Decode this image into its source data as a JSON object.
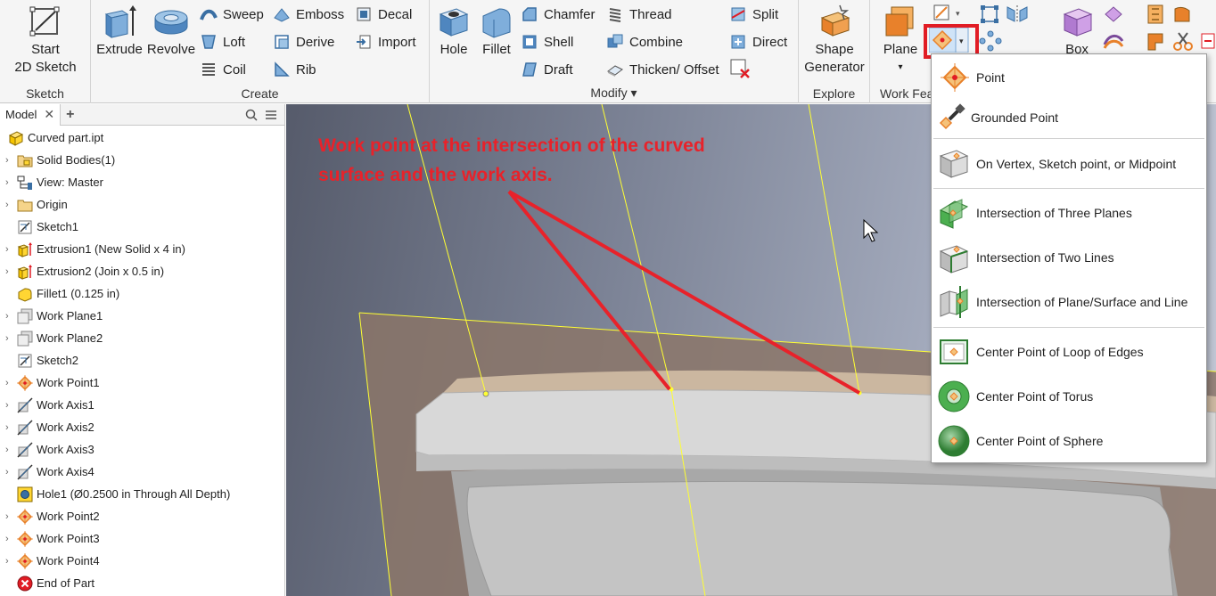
{
  "ribbon": {
    "sketch": {
      "start_label": "Start",
      "sketch_label": "2D Sketch",
      "group": "Sketch"
    },
    "create": {
      "group": "Create",
      "extrude": "Extrude",
      "revolve": "Revolve",
      "sweep": "Sweep",
      "loft": "Loft",
      "coil": "Coil",
      "emboss": "Emboss",
      "derive": "Derive",
      "rib": "Rib",
      "decal": "Decal",
      "import": "Import"
    },
    "modify": {
      "group": "Modify ▾",
      "hole": "Hole",
      "fillet": "Fillet",
      "chamfer": "Chamfer",
      "shell": "Shell",
      "draft": "Draft",
      "thread": "Thread",
      "combine": "Combine",
      "thicken": "Thicken/ Offset",
      "split": "Split",
      "direct": "Direct"
    },
    "explore": {
      "group": "Explore",
      "shape_line1": "Shape",
      "shape_line2": "Generator"
    },
    "work_features": {
      "group": "Work Fea",
      "plane": "Plane"
    },
    "box_label": "Box"
  },
  "browser": {
    "tab": "Model",
    "items": [
      {
        "label": "Curved part.ipt",
        "icon": "part-icon",
        "expander": false
      },
      {
        "label": "Solid Bodies(1)",
        "icon": "solid-bodies-icon",
        "expander": true
      },
      {
        "label": "View: Master",
        "icon": "view-icon",
        "expander": true
      },
      {
        "label": "Origin",
        "icon": "folder-icon",
        "expander": true
      },
      {
        "label": "Sketch1",
        "icon": "sketch-icon",
        "expander": false
      },
      {
        "label": "Extrusion1 (New Solid x 4 in)",
        "icon": "extrusion-icon",
        "expander": true
      },
      {
        "label": "Extrusion2 (Join x 0.5 in)",
        "icon": "extrusion-icon",
        "expander": true
      },
      {
        "label": "Fillet1 (0.125 in)",
        "icon": "fillet-icon",
        "expander": false
      },
      {
        "label": "Work Plane1",
        "icon": "work-plane-icon",
        "expander": true
      },
      {
        "label": "Work Plane2",
        "icon": "work-plane-icon",
        "expander": true
      },
      {
        "label": "Sketch2",
        "icon": "sketch-icon",
        "expander": false
      },
      {
        "label": "Work Point1",
        "icon": "work-point-icon",
        "expander": true
      },
      {
        "label": "Work Axis1",
        "icon": "work-axis-icon",
        "expander": true
      },
      {
        "label": "Work Axis2",
        "icon": "work-axis-icon",
        "expander": true
      },
      {
        "label": "Work Axis3",
        "icon": "work-axis-icon",
        "expander": true
      },
      {
        "label": "Work Axis4",
        "icon": "work-axis-icon",
        "expander": true
      },
      {
        "label": "Hole1 (Ø0.2500 in Through All Depth)",
        "icon": "hole-icon",
        "expander": false
      },
      {
        "label": "Work Point2",
        "icon": "work-point-icon",
        "expander": true
      },
      {
        "label": "Work Point3",
        "icon": "work-point-icon",
        "expander": true
      },
      {
        "label": "Work Point4",
        "icon": "work-point-icon",
        "expander": true
      },
      {
        "label": "End of Part",
        "icon": "end-of-part-icon",
        "expander": false
      }
    ]
  },
  "annotation": {
    "text": "Work point at the intersection of the curved surface and the work axis."
  },
  "dropdown": {
    "items": [
      "Point",
      "Grounded Point",
      "On Vertex, Sketch point, or Midpoint",
      "Intersection of Three Planes",
      "Intersection of Two Lines",
      "Intersection of Plane/Surface and Line",
      "Center Point of Loop of Edges",
      "Center Point of Torus",
      "Center Point of Sphere"
    ]
  },
  "colors": {
    "annotation_red": "#e8222a",
    "highlight_red": "#e11c24",
    "work_point_orange": "#e8812b",
    "sketch_yellow": "#ffff33"
  }
}
